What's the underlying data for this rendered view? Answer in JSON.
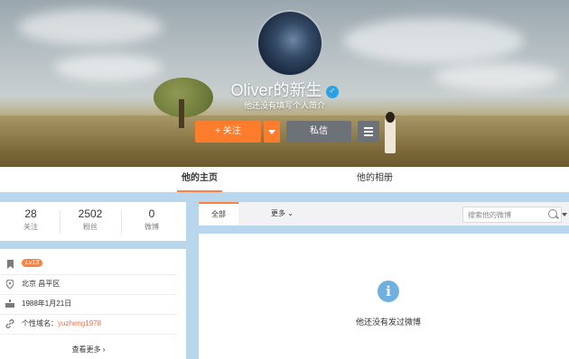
{
  "profile": {
    "name": "Oliver的新生",
    "gender_symbol": "♂",
    "intro": "他还没有填写个人简介",
    "follow_label": "+ 关注",
    "message_label": "私信"
  },
  "tabs": [
    {
      "label": "他的主页",
      "active": true
    },
    {
      "label": "他的相册",
      "active": false
    }
  ],
  "stats": [
    {
      "value": "28",
      "label": "关注"
    },
    {
      "value": "2502",
      "label": "粉丝"
    },
    {
      "value": "0",
      "label": "微博"
    }
  ],
  "info": {
    "level": "Lv13",
    "location": "北京 昌平区",
    "birthday": "1988年1月21日",
    "domain_label": "个性域名：",
    "domain_value": "yuzheng1978",
    "see_more": "查看更多 ›"
  },
  "feed": {
    "filter_all": "全部",
    "filter_more": "更多 ⌄",
    "search_placeholder": "搜索他的微博",
    "empty_text": "他还没有发过微博"
  },
  "icons": {
    "level": "bookmark-icon",
    "location": "location-icon",
    "birthday": "cake-icon",
    "domain": "link-icon",
    "search": "search-icon",
    "menu": "hamburger-icon",
    "empty": "info-icon"
  },
  "colors": {
    "accent": "#ff8140",
    "follow": "#ff7c2d",
    "message": "#6c7278",
    "page_bg": "#b9d7ec"
  }
}
